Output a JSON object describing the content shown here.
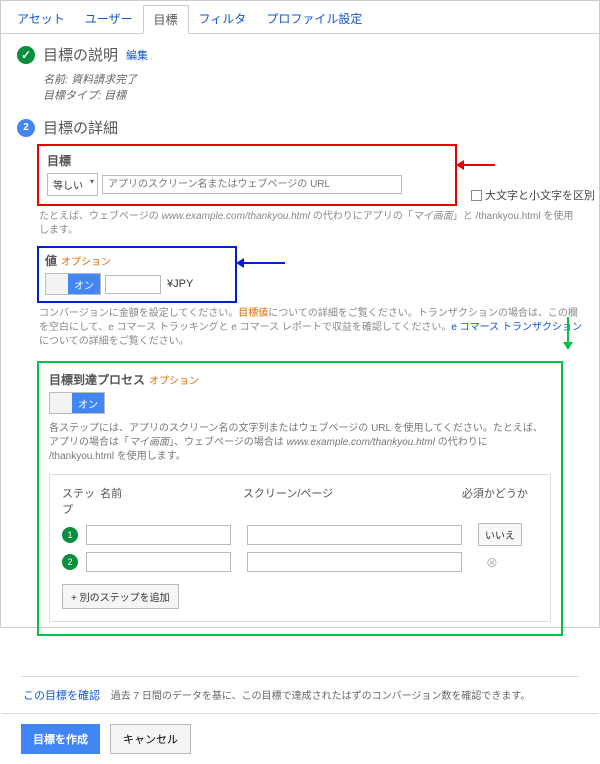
{
  "tabs": [
    "アセット",
    "ユーザー",
    "目標",
    "フィルタ",
    "プロファイル設定"
  ],
  "active_tab": 2,
  "desc": {
    "title": "目標の説明",
    "edit": "編集",
    "name_label": "名前:",
    "name_value": "資料請求完了",
    "type_label": "目標タイプ:",
    "type_value": "目標"
  },
  "details": {
    "title": "目標の詳細",
    "goal": {
      "box_title": "目標",
      "match": "等しい",
      "placeholder": "アプリのスクリーン名またはウェブページの URL",
      "case_label": "大文字と小文字を区別",
      "hint_pre": "たとえば、ウェブページの ",
      "hint_url": "www.example.com/thankyou.html",
      "hint_mid": " の代わりにアプリの「",
      "hint_app": "マイ画面",
      "hint_end": "」と /thankyou.html を使用します。"
    },
    "value": {
      "box_title": "値",
      "optional": "オプション",
      "on": "オン",
      "currency": "¥JPY",
      "hint1": "コンバージョンに金額を設定してください。",
      "hint_em": "目標値",
      "hint2": "についての詳細をご覧ください。トランザクションの場合は、この欄を空白にして、e コマース トラッキングと e コマース レポートで収益を確認してください。",
      "hint_link": "e コマース トランザクション",
      "hint3": "についての詳細をご覧ください。"
    },
    "funnel": {
      "box_title": "目標到達プロセス",
      "optional": "オプション",
      "on": "オン",
      "desc1": "各ステップには、アプリのスクリーン名の文字列またはウェブページの URL を使用してください。たとえば、アプリの場合は「",
      "desc_app": "マイ画面",
      "desc2": "」、ウェブページの場合は ",
      "desc_url": "www.example.com/thankyou.html",
      "desc3": " の代わりに /thankyou.html を使用します。",
      "col_step": "ステップ",
      "col_name": "名前",
      "col_screen": "スクリーン/ページ",
      "col_req": "必須かどうか",
      "req_no": "いいえ",
      "add_step": "+ 別のステップを追加"
    }
  },
  "verify": {
    "link": "この目標を確認",
    "text": "過去 7 日間のデータを基に、この目標で達成されたはずのコンバージョン数を確認できます。"
  },
  "footer": {
    "create": "目標を作成",
    "cancel": "キャンセル"
  }
}
